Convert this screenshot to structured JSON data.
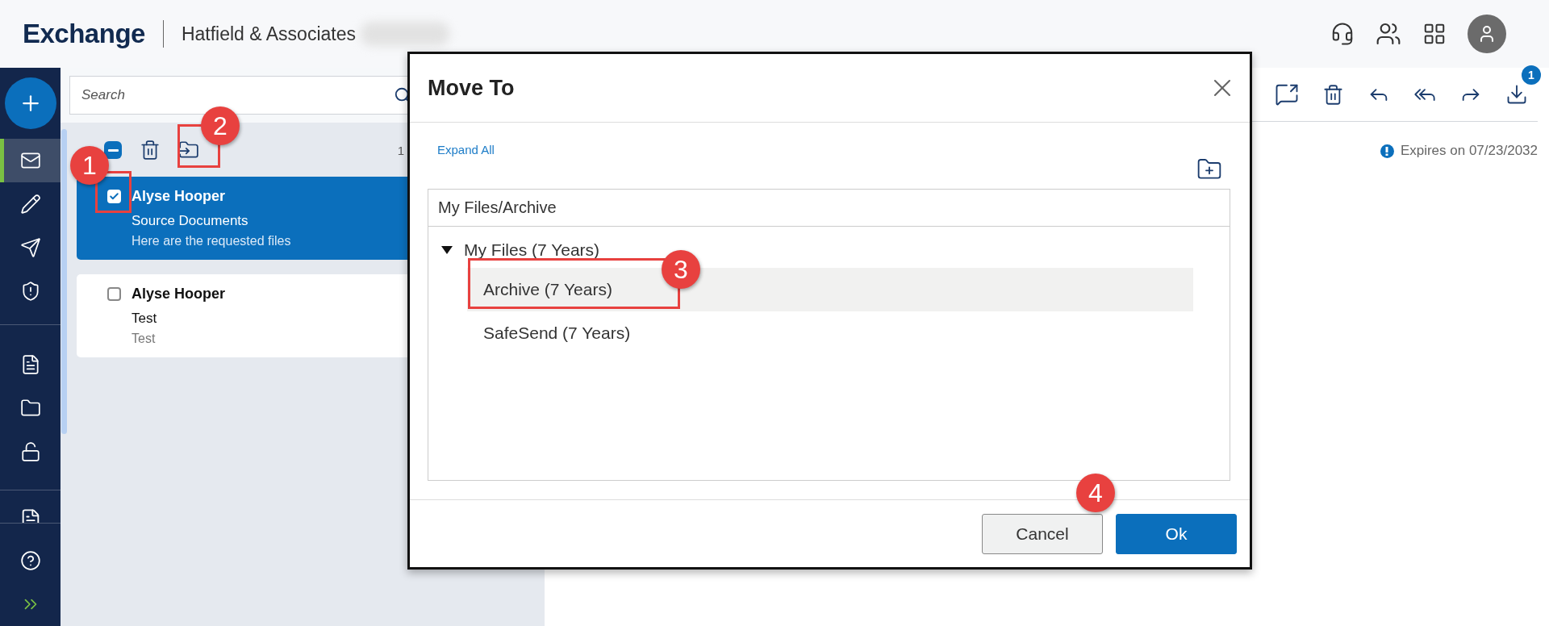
{
  "header": {
    "logo": "Exchange",
    "company": "Hatfield & Associates"
  },
  "nav": {
    "groups": [
      {
        "items": [
          {
            "kind": "mail",
            "selected": true
          },
          {
            "kind": "compose",
            "selected": false
          },
          {
            "kind": "send",
            "selected": false
          },
          {
            "kind": "shield",
            "selected": false
          }
        ]
      },
      {
        "items": [
          {
            "kind": "document",
            "selected": false
          },
          {
            "kind": "folder",
            "selected": false
          },
          {
            "kind": "unlock",
            "selected": false
          }
        ]
      },
      {
        "items": [
          {
            "kind": "partial"
          }
        ]
      },
      {
        "items": [
          {
            "kind": "help",
            "selected": false
          },
          {
            "kind": "expand",
            "selected": false
          }
        ]
      }
    ]
  },
  "search": {
    "placeholder": "Search"
  },
  "list_toolbar": {
    "select_all_partial": true,
    "count": "1"
  },
  "messages": [
    {
      "sender": "Alyse Hooper",
      "subject": "Source Documents",
      "preview": "Here are the requested files",
      "checked": true,
      "selected": true
    },
    {
      "sender": "Alyse Hooper",
      "subject": "Test",
      "preview": "Test",
      "checked": false,
      "selected": false
    }
  ],
  "reading_pane": {
    "attachment_count": "1",
    "expires": "Expires on 07/23/2032"
  },
  "dialog": {
    "title": "Move To",
    "expand_all": "Expand All",
    "path": "My Files/Archive",
    "tree": [
      {
        "label": "My Files (7 Years)",
        "expanded": true,
        "selected": false,
        "children": [
          {
            "label": "Archive (7 Years)",
            "selected": true
          },
          {
            "label": "SafeSend (7 Years)",
            "selected": false
          }
        ]
      }
    ],
    "buttons": [
      {
        "label": "Cancel",
        "kind": "secondary"
      },
      {
        "label": "Ok",
        "kind": "primary"
      }
    ]
  },
  "callouts": [
    {
      "label": "1"
    },
    {
      "label": "2"
    },
    {
      "label": "3"
    },
    {
      "label": "4"
    }
  ]
}
